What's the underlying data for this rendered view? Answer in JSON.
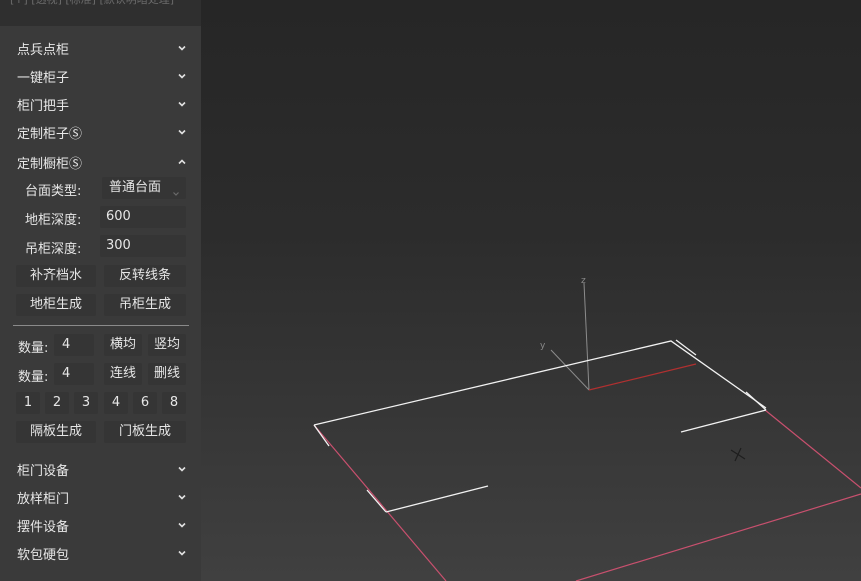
{
  "panel": {
    "topbar_text": "[+] [透视] [标准] [默认明暗处理]",
    "sections_top": [
      {
        "label": "点兵点柜"
      },
      {
        "label": "一键柜子"
      },
      {
        "label": "柜门把手"
      },
      {
        "label": "定制柜子Ⓢ"
      }
    ],
    "expanded_section": {
      "label": "定制橱柜Ⓢ",
      "countertop_label": "台面类型:",
      "countertop_value": "普通台面",
      "base_depth_label": "地柜深度:",
      "base_depth_value": "600",
      "wall_depth_label": "吊柜深度:",
      "wall_depth_value": "300",
      "btn_fill_backsplash": "补齐档水",
      "btn_reverse_lines": "反转线条",
      "btn_base_generate": "地柜生成",
      "btn_wall_generate": "吊柜生成"
    },
    "grid_tools": {
      "qty_label_1": "数量:",
      "qty_value_1": "4",
      "btn_horizontal_even": "横均",
      "btn_vertical_even": "竖均",
      "qty_label_2": "数量:",
      "qty_value_2": "4",
      "btn_connect_lines": "连线",
      "btn_delete_lines": "删线",
      "presets": [
        "1",
        "2",
        "3",
        "4",
        "6",
        "8"
      ],
      "btn_partition_generate": "隔板生成",
      "btn_door_generate": "门板生成"
    },
    "sections_bottom": [
      {
        "label": "柜门设备"
      },
      {
        "label": "放样柜门"
      },
      {
        "label": "摆件设备"
      },
      {
        "label": "软包硬包"
      }
    ]
  },
  "viewport": {
    "axis_z": "z",
    "axis_y": "y",
    "colors": {
      "white_line": "#f2f2f2",
      "pink_line": "#c8506e",
      "red_axis": "#b03030",
      "gray_axis": "#8c8c8c"
    }
  }
}
